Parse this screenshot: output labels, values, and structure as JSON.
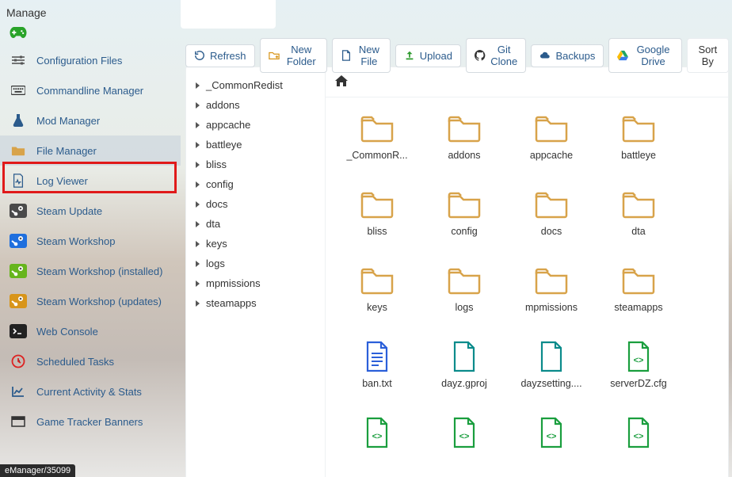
{
  "section_title": "Manage",
  "sidebar": {
    "items": [
      {
        "label": "Configuration Files",
        "icon": "sliders"
      },
      {
        "label": "Commandline Manager",
        "icon": "keyboard"
      },
      {
        "label": "Mod Manager",
        "icon": "flask"
      },
      {
        "label": "File Manager",
        "icon": "folder",
        "active": true
      },
      {
        "label": "Log Viewer",
        "icon": "file-pulse"
      },
      {
        "label": "Steam Update",
        "icon": "steam-dark"
      },
      {
        "label": "Steam Workshop",
        "icon": "steam-blue"
      },
      {
        "label": "Steam Workshop (installed)",
        "icon": "steam-green"
      },
      {
        "label": "Steam Workshop (updates)",
        "icon": "steam-orange"
      },
      {
        "label": "Web Console",
        "icon": "terminal"
      },
      {
        "label": "Scheduled Tasks",
        "icon": "clock"
      },
      {
        "label": "Current Activity & Stats",
        "icon": "chart"
      },
      {
        "label": "Game Tracker Banners",
        "icon": "banner"
      }
    ]
  },
  "toolbar": {
    "refresh": "Refresh",
    "new_folder": "New Folder",
    "new_file": "New File",
    "upload": "Upload",
    "git_clone": "Git Clone",
    "backups": "Backups",
    "google_drive": "Google Drive",
    "sort": "Sort By"
  },
  "tree": [
    "_CommonRedist",
    "addons",
    "appcache",
    "battleye",
    "bliss",
    "config",
    "docs",
    "dta",
    "keys",
    "logs",
    "mpmissions",
    "steamapps"
  ],
  "grid": [
    [
      {
        "type": "folder",
        "label": "_CommonR..."
      },
      {
        "type": "folder",
        "label": "addons"
      },
      {
        "type": "folder",
        "label": "appcache"
      },
      {
        "type": "folder",
        "label": "battleye"
      }
    ],
    [
      {
        "type": "folder",
        "label": "bliss"
      },
      {
        "type": "folder",
        "label": "config"
      },
      {
        "type": "folder",
        "label": "docs"
      },
      {
        "type": "folder",
        "label": "dta"
      }
    ],
    [
      {
        "type": "folder",
        "label": "keys"
      },
      {
        "type": "folder",
        "label": "logs"
      },
      {
        "type": "folder",
        "label": "mpmissions"
      },
      {
        "type": "folder",
        "label": "steamapps"
      }
    ],
    [
      {
        "type": "file-blue",
        "label": "ban.txt"
      },
      {
        "type": "file-teal",
        "label": "dayz.gproj"
      },
      {
        "type": "file-teal",
        "label": "dayzsetting...."
      },
      {
        "type": "file-green",
        "label": "serverDZ.cfg"
      }
    ],
    [
      {
        "type": "file-green",
        "label": ""
      },
      {
        "type": "file-green",
        "label": ""
      },
      {
        "type": "file-green",
        "label": ""
      },
      {
        "type": "file-green",
        "label": ""
      }
    ]
  ],
  "status_text": "eManager/35099"
}
